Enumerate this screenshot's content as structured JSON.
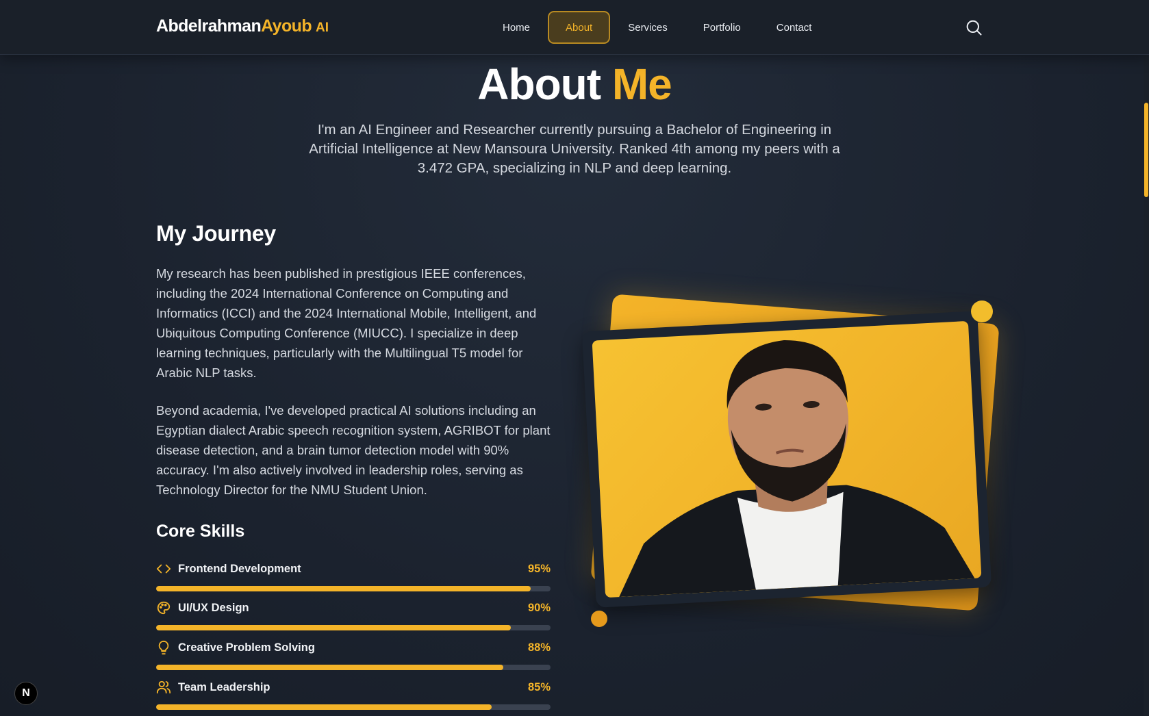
{
  "navbar": {
    "brand_first": "Abdelrahman",
    "brand_last": "Ayoub",
    "brand_suffix": "AI",
    "links": [
      "Home",
      "About",
      "Services",
      "Portfolio",
      "Contact"
    ],
    "active": "About",
    "search_icon": "search-icon"
  },
  "hero": {
    "title_main": "About",
    "title_accent": "Me",
    "subtitle": "I'm an AI Engineer and Researcher currently pursuing a Bachelor of Engineering in Artificial Intelligence at New Mansoura University. Ranked 4th among my peers with a 3.472 GPA, specializing in NLP and deep learning."
  },
  "journey": {
    "heading": "My Journey",
    "paragraph_1": "My research has been published in prestigious IEEE conferences, including the 2024 International Conference on Computing and Informatics (ICCI) and the 2024 International Mobile, Intelligent, and Ubiquitous Computing Conference (MIUCC). I specialize in deep learning techniques, particularly with the Multilingual T5 model for Arabic NLP tasks.",
    "paragraph_2": "Beyond academia, I've developed practical AI solutions including an Egyptian dialect Arabic speech recognition system, AGRIBOT for plant disease detection, and a brain tumor detection model with 90% accuracy. I'm also actively involved in leadership roles, serving as Technology Director for the NMU Student Union."
  },
  "skills": {
    "heading": "Core Skills",
    "items": [
      {
        "name": "Frontend Development",
        "pct_label": "95%",
        "value": 95,
        "icon": "code-icon"
      },
      {
        "name": "UI/UX Design",
        "pct_label": "90%",
        "value": 90,
        "icon": "palette-icon"
      },
      {
        "name": "Creative Problem Solving",
        "pct_label": "88%",
        "value": 88,
        "icon": "lightbulb-icon"
      },
      {
        "name": "Team Leadership",
        "pct_label": "85%",
        "value": 85,
        "icon": "users-icon"
      }
    ]
  },
  "badge": {
    "label": "N"
  },
  "colors": {
    "accent": "#f4b429",
    "background": "#1c2330",
    "bar_track": "#3a4250"
  }
}
